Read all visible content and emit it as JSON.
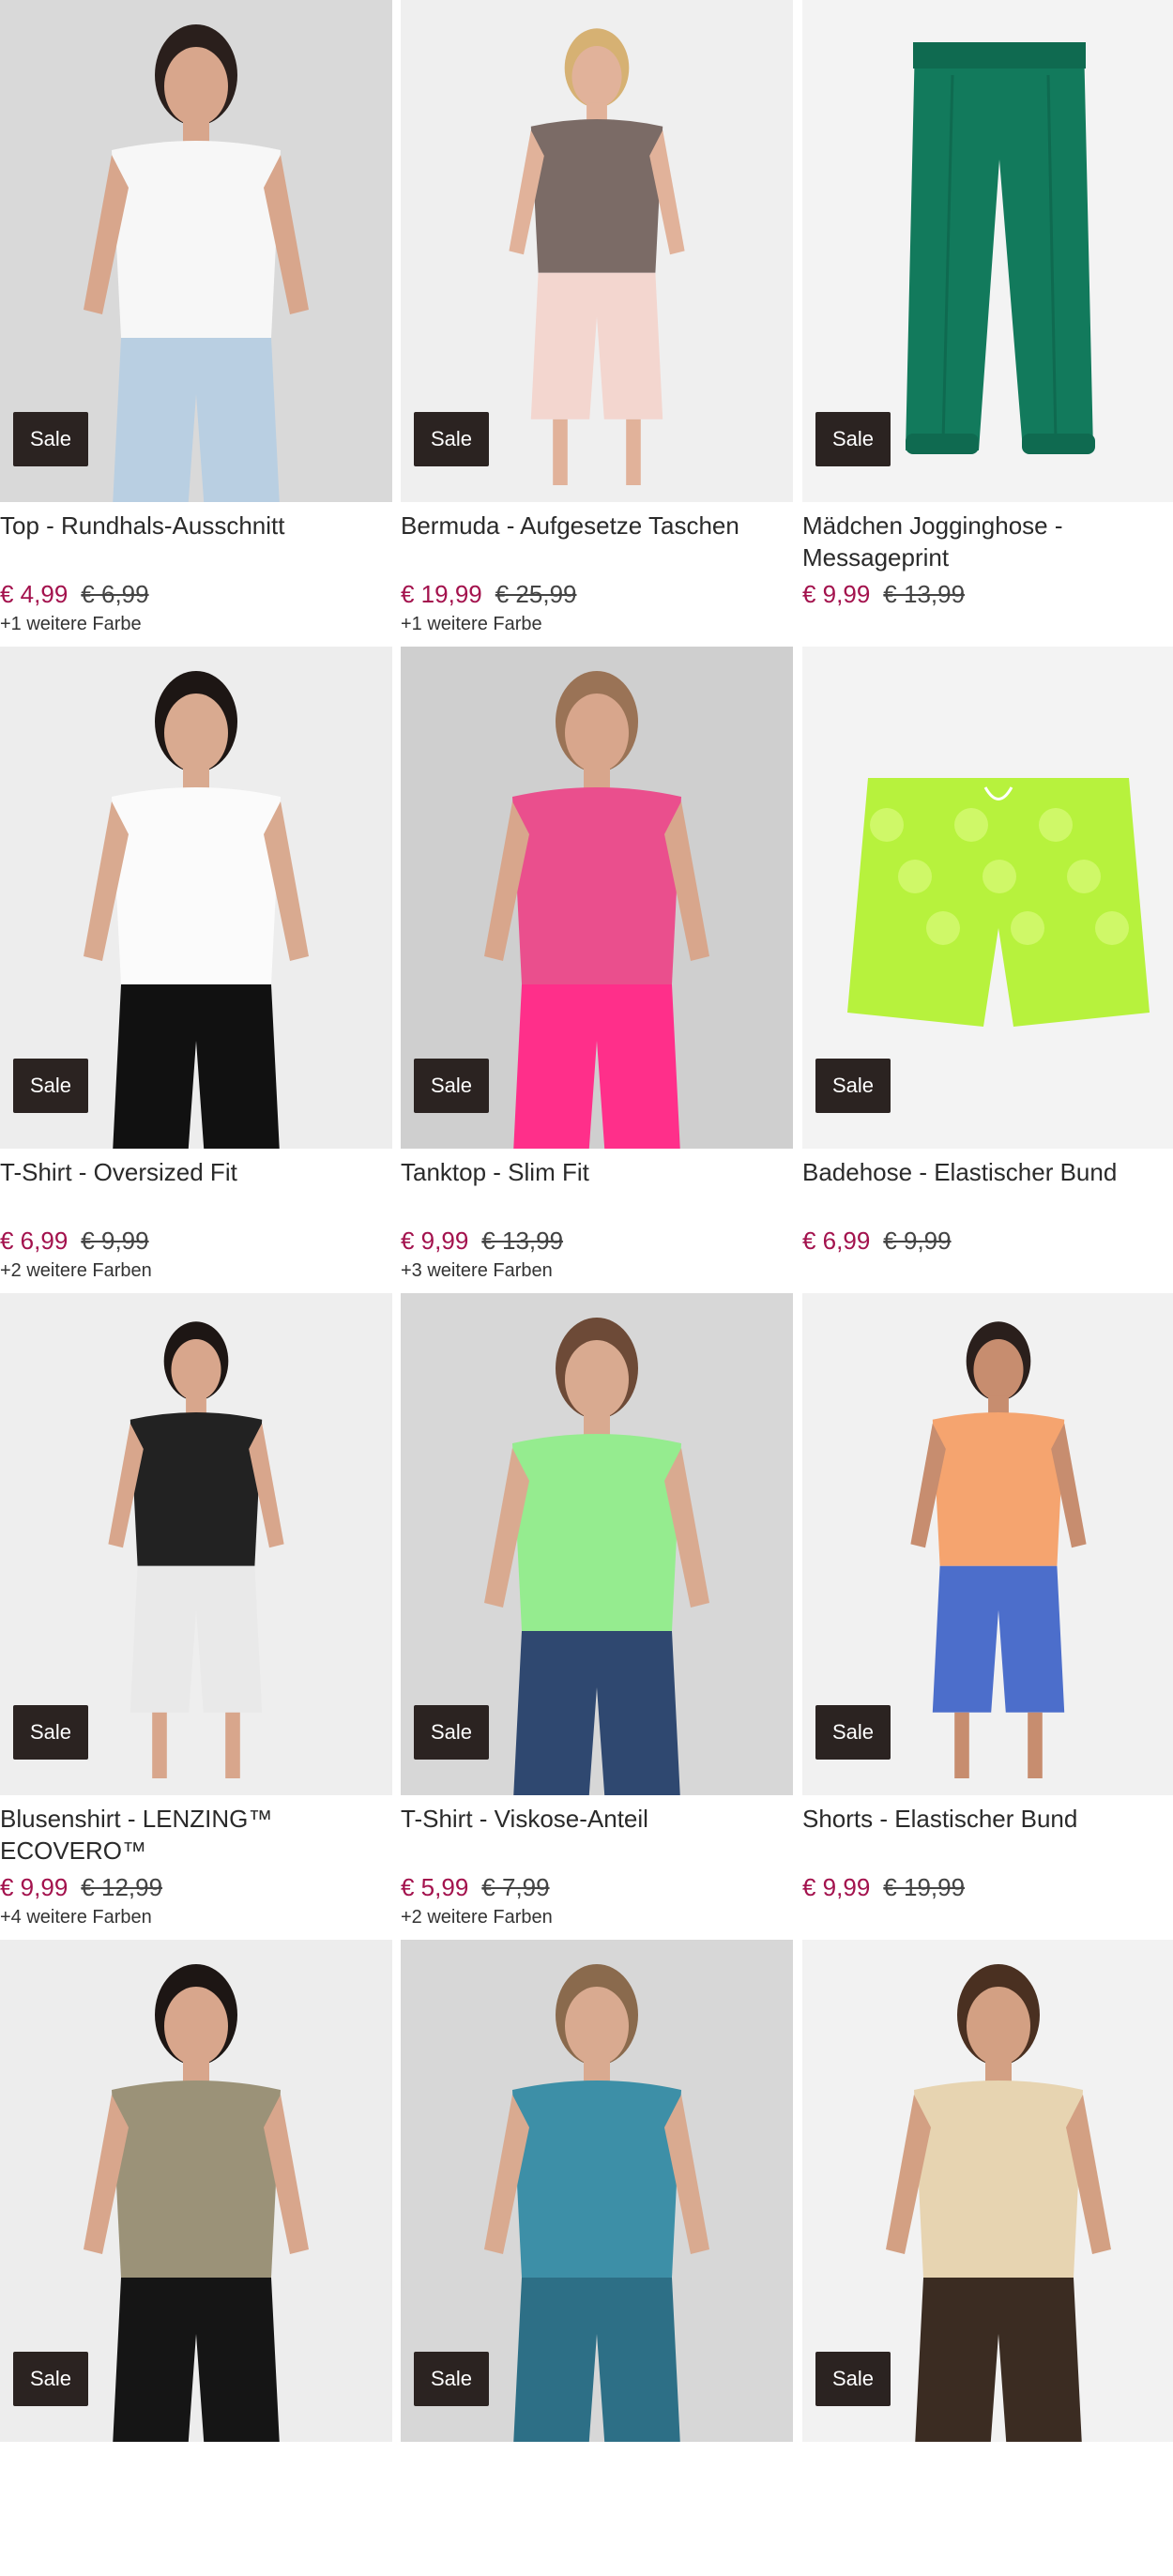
{
  "products": [
    {
      "title": "Top - Rundhals-Ausschnitt",
      "price": "€ 4,99",
      "old_price": "€ 6,99",
      "colors": "+1 weitere Farbe",
      "badge": "Sale",
      "art": {
        "bg": "#d9d9d9",
        "main": "#f7f7f7",
        "secondary": "#b9cfe2",
        "skin": "#d8a68c",
        "hair": "#2a1f1c",
        "kind": "model"
      }
    },
    {
      "title": "Bermuda - Aufgesetze Taschen",
      "price": "€ 19,99",
      "old_price": "€ 25,99",
      "colors": "+1 weitere Farbe",
      "badge": "Sale",
      "art": {
        "bg": "#efefef",
        "main": "#7b6b66",
        "secondary": "#f3d6cf",
        "skin": "#e1b29a",
        "hair": "#d6b173",
        "kind": "model-small"
      }
    },
    {
      "title": "Mädchen Jogginghose - Messageprint",
      "price": "€ 9,99",
      "old_price": "€ 13,99",
      "colors": "",
      "badge": "Sale",
      "art": {
        "bg": "#f3f3f3",
        "main": "#127a5c",
        "secondary": "#0f6a50",
        "skin": "#000000",
        "hair": "#000000",
        "kind": "pants"
      }
    },
    {
      "title": "T-Shirt - Oversized Fit",
      "price": "€ 6,99",
      "old_price": "€ 9,99",
      "colors": "+2 weitere Farben",
      "badge": "Sale",
      "art": {
        "bg": "#ededed",
        "main": "#fbfbfb",
        "secondary": "#111111",
        "skin": "#d9aa90",
        "hair": "#1d1614",
        "kind": "model"
      }
    },
    {
      "title": "Tanktop - Slim Fit",
      "price": "€ 9,99",
      "old_price": "€ 13,99",
      "colors": "+3 weitere Farben",
      "badge": "Sale",
      "art": {
        "bg": "#cfcfcf",
        "main": "#ea4f8d",
        "secondary": "#ff2f8a",
        "skin": "#d8a68c",
        "hair": "#9a7356",
        "kind": "model"
      }
    },
    {
      "title": "Badehose - Elastischer Bund",
      "price": "€ 6,99",
      "old_price": "€ 9,99",
      "colors": "",
      "badge": "Sale",
      "art": {
        "bg": "#f3f3f3",
        "main": "#b7f23d",
        "secondary": "#d9fb7a",
        "skin": "#000000",
        "hair": "#000000",
        "kind": "shorts"
      }
    },
    {
      "title": "Blusenshirt - LENZING™ ECOVERO™",
      "price": "€ 9,99",
      "old_price": "€ 12,99",
      "colors": "+4 weitere Farben",
      "badge": "Sale",
      "art": {
        "bg": "#eeeeee",
        "main": "#222222",
        "secondary": "#e9e9e9",
        "skin": "#d8a68c",
        "hair": "#1d1614",
        "kind": "model-small"
      }
    },
    {
      "title": "T-Shirt - Viskose-Anteil",
      "price": "€ 5,99",
      "old_price": "€ 7,99",
      "colors": "+2 weitere Farben",
      "badge": "Sale",
      "art": {
        "bg": "#d7d7d7",
        "main": "#95ec8f",
        "secondary": "#2f4870",
        "skin": "#d9aa90",
        "hair": "#6d4a37",
        "kind": "model"
      }
    },
    {
      "title": "Shorts - Elastischer Bund",
      "price": "€ 9,99",
      "old_price": "€ 19,99",
      "colors": "",
      "badge": "Sale",
      "art": {
        "bg": "#f1f1f1",
        "main": "#f5a46f",
        "secondary": "#4c6ecb",
        "skin": "#c78d6f",
        "hair": "#2a1f1c",
        "kind": "model-small"
      }
    },
    {
      "title": "",
      "price": "",
      "old_price": "",
      "colors": "",
      "badge": "Sale",
      "art": {
        "bg": "#ededed",
        "main": "#9b9278",
        "secondary": "#151515",
        "skin": "#d8a68c",
        "hair": "#1d1614",
        "kind": "model"
      }
    },
    {
      "title": "",
      "price": "",
      "old_price": "",
      "colors": "",
      "badge": "Sale",
      "art": {
        "bg": "#d7d7d7",
        "main": "#3d8fa7",
        "secondary": "#2d6f86",
        "skin": "#d9aa90",
        "hair": "#8a6a4d",
        "kind": "model"
      }
    },
    {
      "title": "",
      "price": "",
      "old_price": "",
      "colors": "",
      "badge": "Sale",
      "art": {
        "bg": "#f2f2f2",
        "main": "#e7d4b1",
        "secondary": "#3b2c22",
        "skin": "#d3a083",
        "hair": "#4a3021",
        "kind": "model"
      }
    }
  ]
}
